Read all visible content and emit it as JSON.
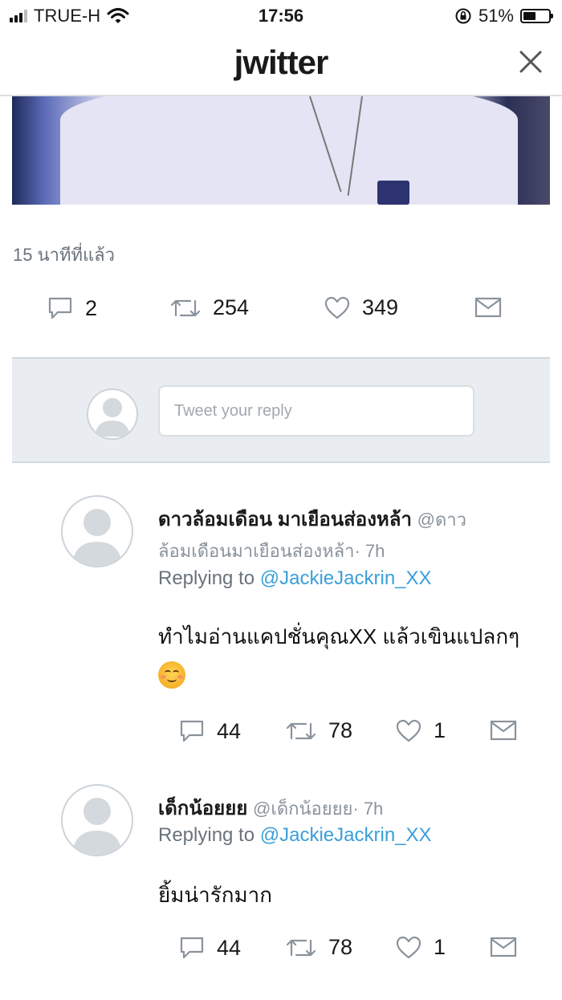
{
  "status_bar": {
    "carrier": "TRUE-H",
    "time": "17:56",
    "battery_percent": "51%",
    "battery_level": 0.51
  },
  "header": {
    "logo": "jwitter"
  },
  "main_tweet": {
    "timestamp": "15 นาทีที่แล้ว",
    "replies": "2",
    "retweets": "254",
    "likes": "349"
  },
  "reply_box": {
    "placeholder": "Tweet your reply"
  },
  "replies": [
    {
      "name": "ดาวล้อมเดือน มาเยือนส่องหล้า",
      "handle_part1": "@ดาว",
      "handle_part2": "ล้อมเดือนมาเยือนส่องหล้า· 7h",
      "replying_prefix": "Replying to",
      "replying_to": "@JackieJackrin_XX",
      "text": "ทำไมอ่านแคปชั่นคุณXX แล้วเขินแปลกๆ",
      "emoji": "smiling-face-icon",
      "reply_count": "44",
      "retweet_count": "78",
      "like_count": "1"
    },
    {
      "name": "เด็กน้อยยย",
      "handle": "@เด็กน้อยยย· 7h",
      "replying_prefix": "Replying to",
      "replying_to": "@JackieJackrin_XX",
      "text": "ยิ้มน่ารักมาก",
      "reply_count": "44",
      "retweet_count": "78",
      "like_count": "1"
    }
  ],
  "colors": {
    "accent": "#3a9fd8",
    "muted": "#6a737c",
    "icon": "#8a939c",
    "reply_bg": "#e9edf2"
  }
}
